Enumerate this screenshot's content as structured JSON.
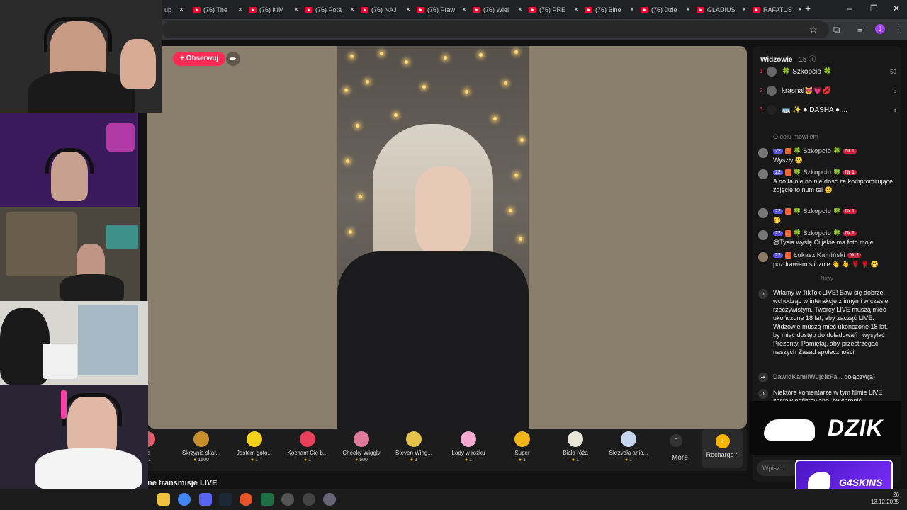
{
  "browser": {
    "tabs": [
      {
        "label": "(76) The"
      },
      {
        "label": "(76) KIM"
      },
      {
        "label": "(76) Pota"
      },
      {
        "label": "(76) NAJ"
      },
      {
        "label": "(76) Praw"
      },
      {
        "label": "(76) Wiel"
      },
      {
        "label": "(76) PRE"
      },
      {
        "label": "(76) Bine"
      },
      {
        "label": "(76) Dzie"
      },
      {
        "label": "GLADIUS"
      },
      {
        "label": "RAFATUS"
      }
    ],
    "profile_initial": "J"
  },
  "stream": {
    "follow_label": "+ Obserwuj",
    "bottom_text": "ne transmisje LIVE"
  },
  "gifts": [
    {
      "name": "ża",
      "cost": "1",
      "icon": "rose-icon",
      "color": "#e05a6a"
    },
    {
      "name": "Skrzynia skar...",
      "cost": "1500",
      "icon": "treasure-chest-icon",
      "color": "#c8902c"
    },
    {
      "name": "Jestem goto...",
      "cost": "1",
      "icon": "sponge-icon",
      "color": "#f2d21b"
    },
    {
      "name": "Kocham Cię b...",
      "cost": "1",
      "icon": "heart-face-icon",
      "color": "#e8405a"
    },
    {
      "name": "Cheeky Wiggly",
      "cost": "500",
      "icon": "wiggly-icon",
      "color": "#e07a9a"
    },
    {
      "name": "Steven Wing...",
      "cost": "1",
      "icon": "bee-icon",
      "color": "#e6c24a"
    },
    {
      "name": "Lody w rożku",
      "cost": "1",
      "icon": "ice-cream-icon",
      "color": "#f3a9cf"
    },
    {
      "name": "Super",
      "cost": "1",
      "icon": "sunglasses-face-icon",
      "color": "#f2b51a"
    },
    {
      "name": "Biała róża",
      "cost": "1",
      "icon": "white-rose-icon",
      "color": "#e8e4d8"
    },
    {
      "name": "Skrzydła anio...",
      "cost": "1",
      "icon": "angel-wings-icon",
      "color": "#c7d6ee"
    }
  ],
  "gifts_more_label": "More",
  "recharge_label": "Recharge ^",
  "viewers": {
    "title": "Widzowie",
    "count": "· 15",
    "list": [
      {
        "rank": "1",
        "name": "🍀 Szkopcio 🍀",
        "score": "59"
      },
      {
        "rank": "2",
        "name": "krasnal😻💗💋",
        "score": "5"
      },
      {
        "rank": "3",
        "name": "🚌 ✨ ● DASHA ● ...",
        "score": "3"
      }
    ]
  },
  "chat": {
    "top_system": "O celu mowiłem",
    "messages": [
      {
        "level": "22",
        "user": "🍀 Szkopcio 🍀",
        "rank_badge": "Nr 1",
        "text": "Wyszły 🥴"
      },
      {
        "level": "22",
        "user": "🍀 Szkopcio 🍀",
        "rank_badge": "Nr 1",
        "text": "A no ta nie no nie dość że kompromitujące zdjęcie to num tel 🥴"
      },
      {
        "level": "22",
        "user": "🍀 Szkopcio 🍀",
        "rank_badge": "Nr 1",
        "text": "🥴"
      },
      {
        "level": "22",
        "user": "🍀 Szkopcio 🍀",
        "rank_badge": "Nr 1",
        "text": "@Tysia wyślę Ci jakie ma foto moje"
      },
      {
        "level": "22",
        "user": "Łukasz Kamiński",
        "rank_badge": "Nr 2",
        "text": "pozdrawiam ślicznie 👋 👋 🌹 🌹 🥴"
      }
    ],
    "new_divider": "Nowy",
    "welcome": "Witamy w TikTok LIVE! Baw się dobrze, wchodząc w interakcje z innymi w czasie rzeczywistym. Twórcy LIVE muszą mieć ukończone 18 lat, aby zacząć LIVE. Widzowie muszą mieć ukończone 18 lat, by mieć dostęp do doładowań i wysyłać Prezenty. Pamiętaj, aby przestrzegać naszych Zasad społeczności.",
    "joined_user": "DawidKamilWujcikFa...",
    "joined_text": "dołączył(a)",
    "filtered_note": "Niektóre komentarze w tym filmie LIVE zostały odfiltrowane, by chronić",
    "input_placeholder": "Wpisz..."
  },
  "overlays": {
    "dzik_label": "DZIK",
    "g4_label": "G4SKINS"
  },
  "taskbar": {
    "time": "26",
    "date": "13.12.2025"
  }
}
